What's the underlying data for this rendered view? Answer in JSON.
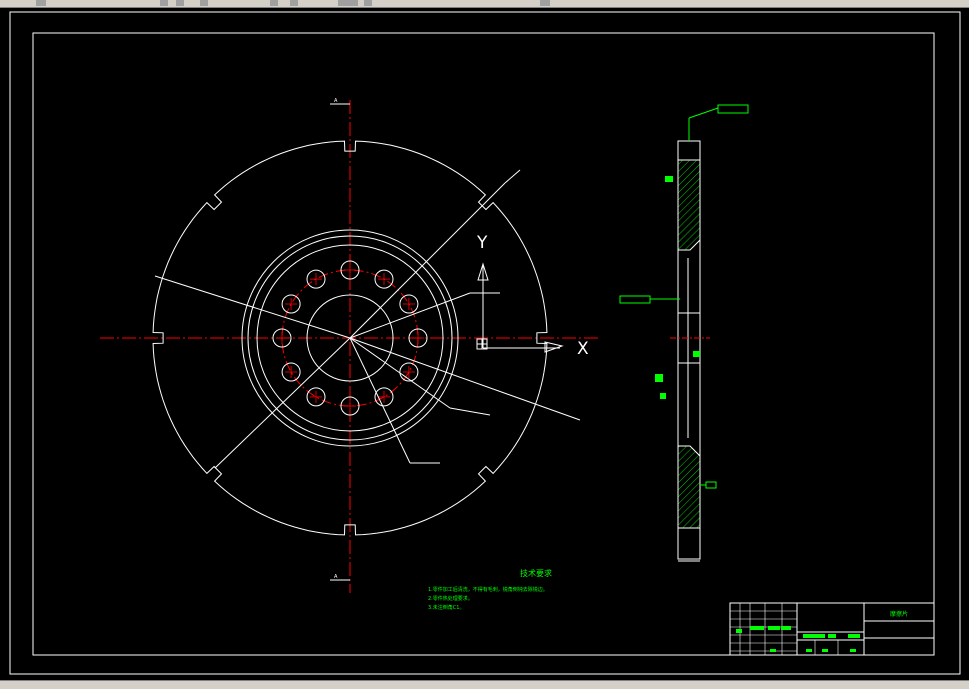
{
  "drawing": {
    "axis_x_label": "X",
    "axis_y_label": "Y",
    "section_mark_top": "A",
    "section_mark_bottom": "A",
    "tech_req_title": "技术要求",
    "tech_req_lines": [
      "1.零件加工后清洗，不得有毛刺，锐角倒钝去除锐边。",
      "2.零件热处理要求。",
      "3.未注倒角C1。"
    ],
    "title_block_name": "摩擦片"
  },
  "colors": {
    "background": "#000000",
    "lines": "#ffffff",
    "centerline": "#ff0000",
    "annotation": "#00ff00",
    "hatch": "#00ff00",
    "hole": "#ff0000"
  }
}
